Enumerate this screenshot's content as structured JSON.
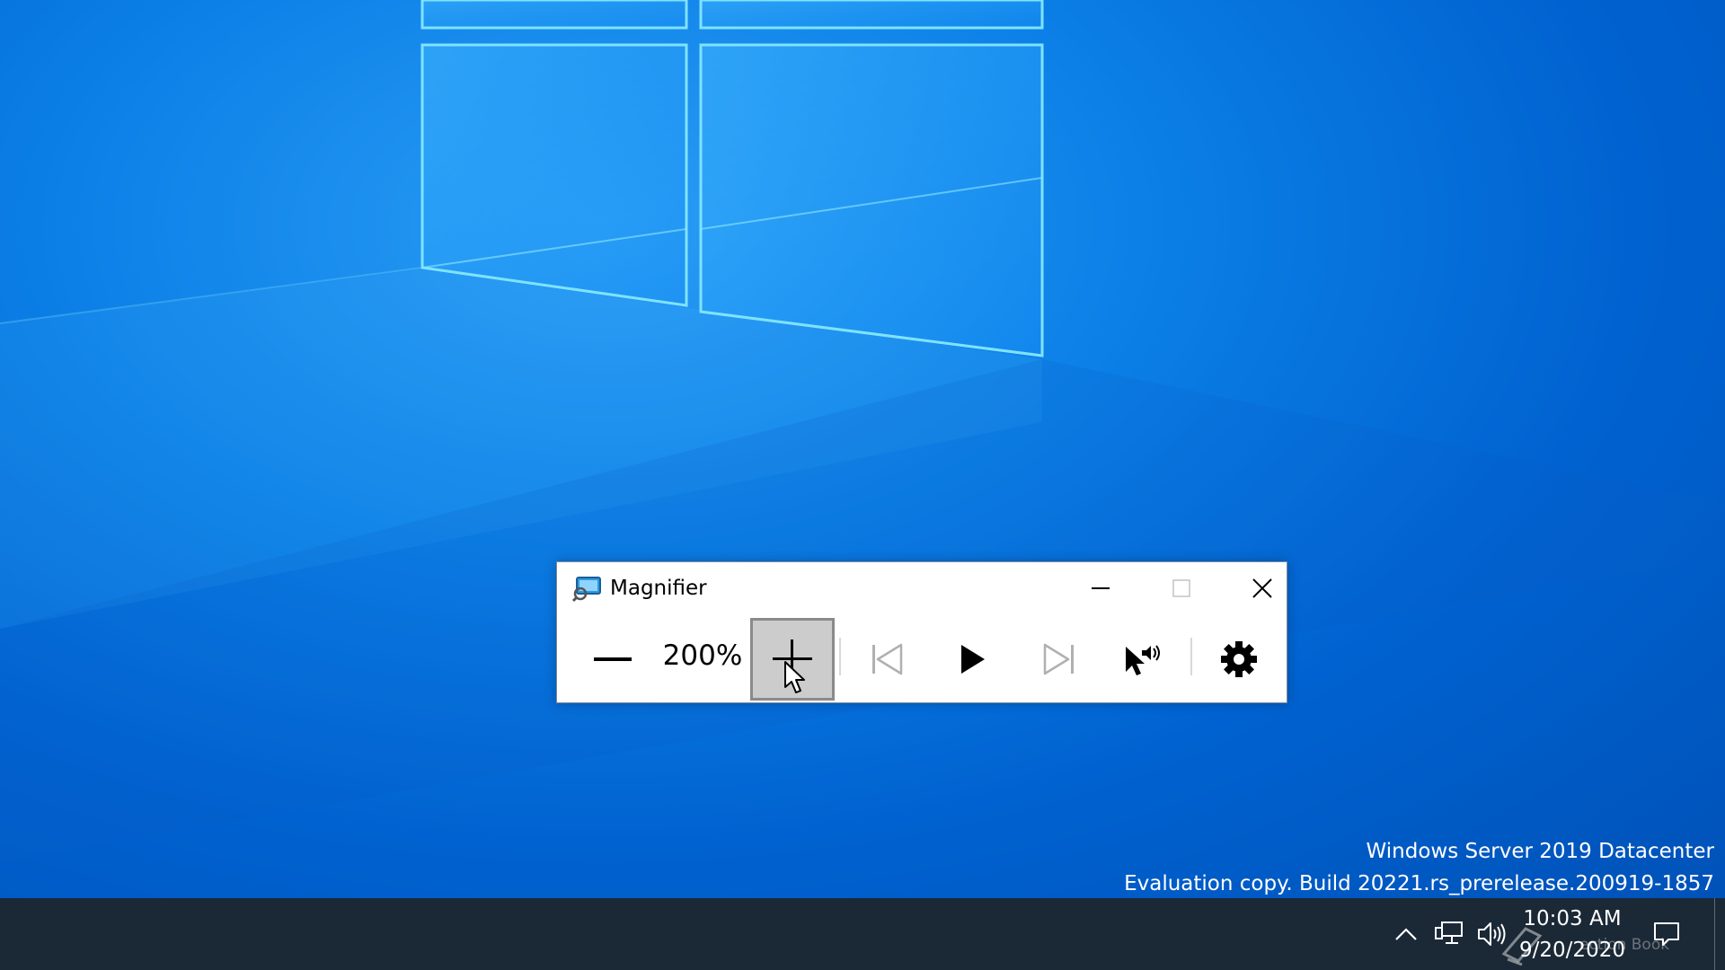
{
  "window": {
    "title": "Magnifier",
    "zoom_level": "200%"
  },
  "toolbar": {
    "buttons": [
      {
        "name": "zoom-out",
        "icon": "minus-icon"
      },
      {
        "name": "zoom-in",
        "icon": "plus-icon",
        "state": "pressed"
      },
      {
        "name": "previous",
        "icon": "skip-back-icon",
        "state": "disabled"
      },
      {
        "name": "play",
        "icon": "play-icon"
      },
      {
        "name": "next",
        "icon": "skip-forward-icon",
        "state": "disabled"
      },
      {
        "name": "read-from-here",
        "icon": "pointer-speaker-icon"
      },
      {
        "name": "settings",
        "icon": "gear-icon"
      }
    ]
  },
  "caption_buttons": [
    "minimize-icon",
    "maximize-icon",
    "close-icon"
  ],
  "watermark": {
    "line1": "Windows Server 2019 Datacenter",
    "line2": "Evaluation copy. Build 20221.rs_prerelease.200919-1857"
  },
  "taskbar": {
    "time": "10:03 AM",
    "date": "9/20/2020",
    "overlay_text": "ection Book",
    "tray_icons": [
      "chevron-up-icon",
      "network-icon",
      "volume-icon",
      "notification-icon"
    ]
  },
  "colors": {
    "desktop_blue": "#0b7fe6",
    "taskbar": "#1b2836",
    "pressed_button": "#cccccc"
  }
}
